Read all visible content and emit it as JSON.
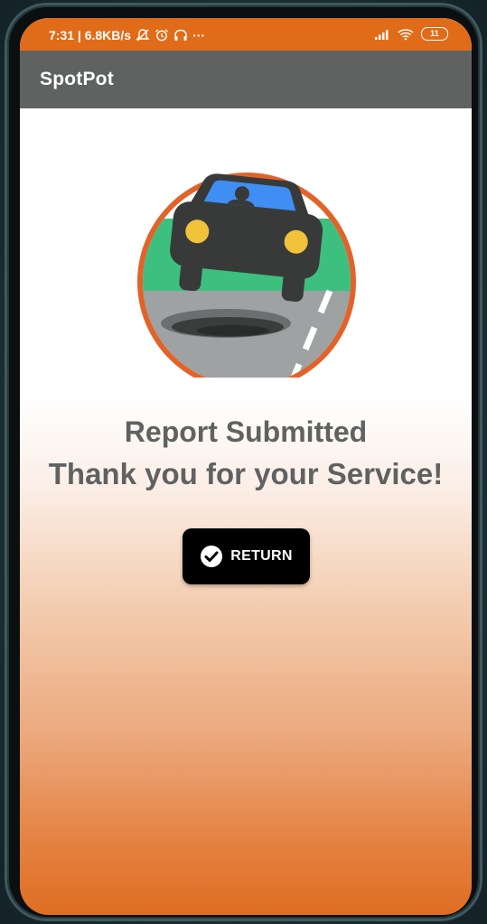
{
  "status_bar": {
    "time_speed": "7:31 | 6.8KB/s",
    "more": "···",
    "battery": "11",
    "icons": [
      "notification-off-icon",
      "alarm-icon",
      "headphones-icon",
      "signal-icon",
      "wifi-icon",
      "battery-icon"
    ]
  },
  "app_bar": {
    "title": "SpotPot"
  },
  "main": {
    "logo_icon": "car-pothole-logo",
    "message_line1": "Report Submitted",
    "message_line2": "Thank you for your Service!",
    "return_button": {
      "label": "RETURN",
      "icon": "check-circle-icon"
    }
  },
  "colors": {
    "status_bar": "#e06c19",
    "app_bar": "#5f6261",
    "text": "#5f6261",
    "button": "#000000",
    "gradient_bottom": "#df6e22",
    "logo_ring": "#e2632a",
    "logo_grass": "#3dbf80",
    "logo_windshield": "#3f8ef3",
    "logo_headlight": "#f0c33b"
  }
}
